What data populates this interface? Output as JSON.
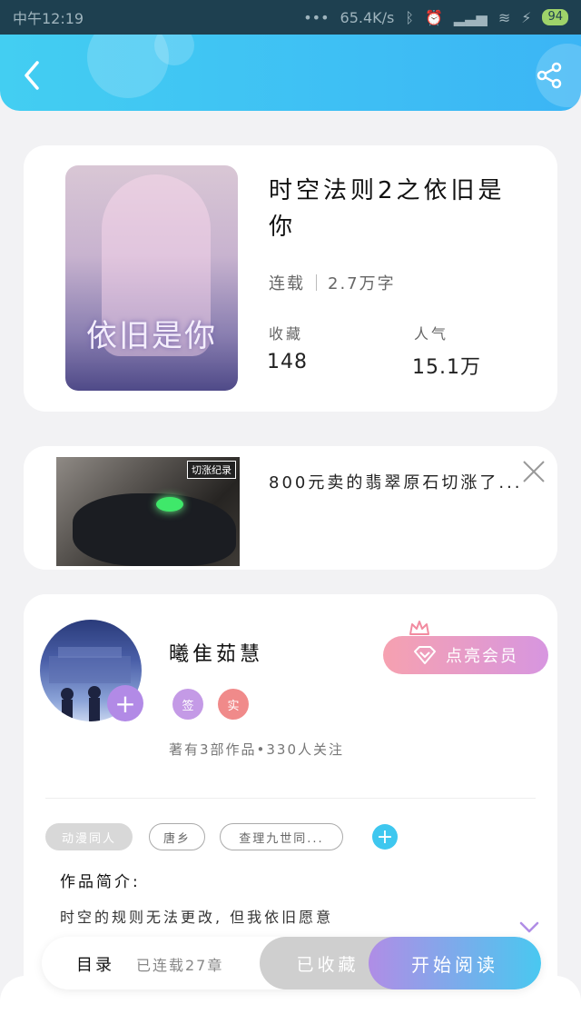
{
  "status_bar": {
    "time": "中午12:19",
    "network_speed": "65.4K/s",
    "battery": "94"
  },
  "header": {
    "back_icon": "chevron-left-icon",
    "share_icon": "share-icon"
  },
  "book": {
    "title": "时空法则2之依旧是你",
    "status": "连载",
    "word_count": "2.7万字",
    "favorites_label": "收藏",
    "favorites_value": "148",
    "popularity_label": "人气",
    "popularity_value": "15.1万",
    "cover_text": "依旧是你"
  },
  "ad": {
    "title": "800元卖的翡翠原石切涨了...",
    "thumb_tag": "切涨纪录"
  },
  "author": {
    "name": "曦隹茹慧",
    "vip_button": "点亮会员",
    "badge_sign": "签",
    "badge_real": "实",
    "stats": "著有3部作品•330人关注"
  },
  "tags": [
    "动漫同人",
    "唐乡",
    "查理九世同..."
  ],
  "intro": {
    "label": "作品简介:",
    "text": "时空的规则无法更改, 但我依旧愿意"
  },
  "bottom_bar": {
    "toc_label": "目录",
    "chapters": "已连载27章",
    "collected_button": "已收藏",
    "read_button": "开始阅读"
  },
  "colors": {
    "header_start": "#43cef2",
    "header_end": "#3bb5f5",
    "vip_start": "#f6a1b0",
    "vip_end": "#d796e0",
    "read_start": "#b08de6",
    "read_end": "#49c8f0"
  }
}
